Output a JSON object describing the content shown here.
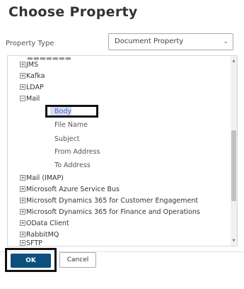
{
  "dialog": {
    "title": "Choose Property",
    "property_type_label": "Property Type",
    "property_type_value": "Document Property"
  },
  "tree": {
    "items": [
      {
        "label": "JMS",
        "expander": "+"
      },
      {
        "label": "Kafka",
        "expander": "+"
      },
      {
        "label": "LDAP",
        "expander": "+"
      },
      {
        "label": "Mail",
        "expander": "−"
      },
      {
        "label": "Body",
        "expander": "",
        "selected": true
      },
      {
        "label": "File Name",
        "expander": ""
      },
      {
        "label": "Subject",
        "expander": ""
      },
      {
        "label": "From Address",
        "expander": ""
      },
      {
        "label": "To Address",
        "expander": ""
      },
      {
        "label": "Mail (IMAP)",
        "expander": "+"
      },
      {
        "label": "Microsoft Azure Service Bus",
        "expander": "+"
      },
      {
        "label": "Microsoft Dynamics 365 for Customer Engagement",
        "expander": "+"
      },
      {
        "label": "Microsoft Dynamics 365 for Finance and Operations",
        "expander": "+"
      },
      {
        "label": "OData Client",
        "expander": "+"
      },
      {
        "label": "RabbitMQ",
        "expander": "+"
      },
      {
        "label": "SFTP",
        "expander": "+"
      }
    ]
  },
  "buttons": {
    "ok": "OK",
    "cancel": "Cancel"
  },
  "colors": {
    "ok_bg": "#0b4f7d",
    "selection_bg": "#dcdcf0",
    "selection_text": "#3b6cc4"
  }
}
